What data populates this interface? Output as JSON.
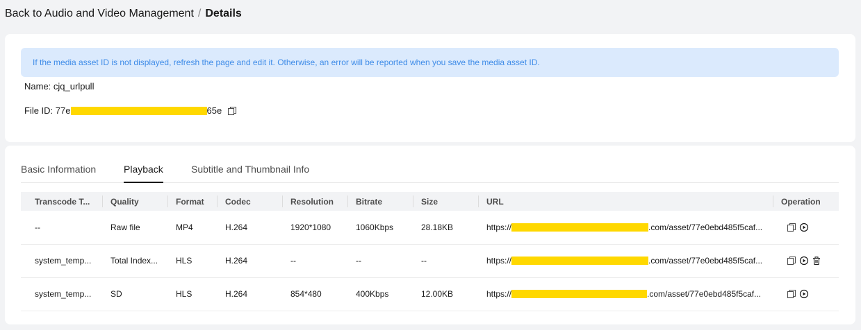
{
  "breadcrumb": {
    "back_label": "Back to Audio and Video Management",
    "separator": "/",
    "current": "Details"
  },
  "notice": {
    "text": "If the media asset ID is not displayed, refresh the page and edit it. Otherwise, an error will be reported when you save the media asset ID."
  },
  "asset": {
    "name_label": "Name:",
    "name_value": "cjq_urlpull",
    "file_id_label": "File ID:",
    "file_id_prefix": "77e",
    "file_id_suffix": "65e"
  },
  "tabs": [
    {
      "label": "Basic Information",
      "active": false
    },
    {
      "label": "Playback",
      "active": true
    },
    {
      "label": "Subtitle and Thumbnail Info",
      "active": false
    }
  ],
  "table": {
    "headers": [
      "Transcode T...",
      "Quality",
      "Format",
      "Codec",
      "Resolution",
      "Bitrate",
      "Size",
      "URL",
      "Operation"
    ],
    "rows": [
      {
        "template": "--",
        "quality": "Raw file",
        "format": "MP4",
        "codec": "H.264",
        "resolution": "1920*1080",
        "bitrate": "1060Kbps",
        "size": "28.18KB",
        "url_prefix": "https://",
        "url_suffix": ".com/asset/77e0ebd485f5caf...",
        "has_delete": false
      },
      {
        "template": "system_temp...",
        "quality": "Total Index...",
        "format": "HLS",
        "codec": "H.264",
        "resolution": "--",
        "bitrate": "--",
        "size": "--",
        "url_prefix": "https://",
        "url_suffix": ".com/asset/77e0ebd485f5caf...",
        "has_delete": true
      },
      {
        "template": "system_temp...",
        "quality": "SD",
        "format": "HLS",
        "codec": "H.264",
        "resolution": "854*480",
        "bitrate": "400Kbps",
        "size": "12.00KB",
        "url_prefix": "https://",
        "url_suffix": ".com/asset/77e0ebd485f5caf...",
        "has_delete": false
      }
    ]
  },
  "colors": {
    "notice_bg": "#dbeafd",
    "notice_text": "#3f8ce8",
    "redaction": "#ffd800"
  },
  "icons": {
    "copy": "copy-icon",
    "play": "play-icon",
    "delete": "trash-icon"
  }
}
